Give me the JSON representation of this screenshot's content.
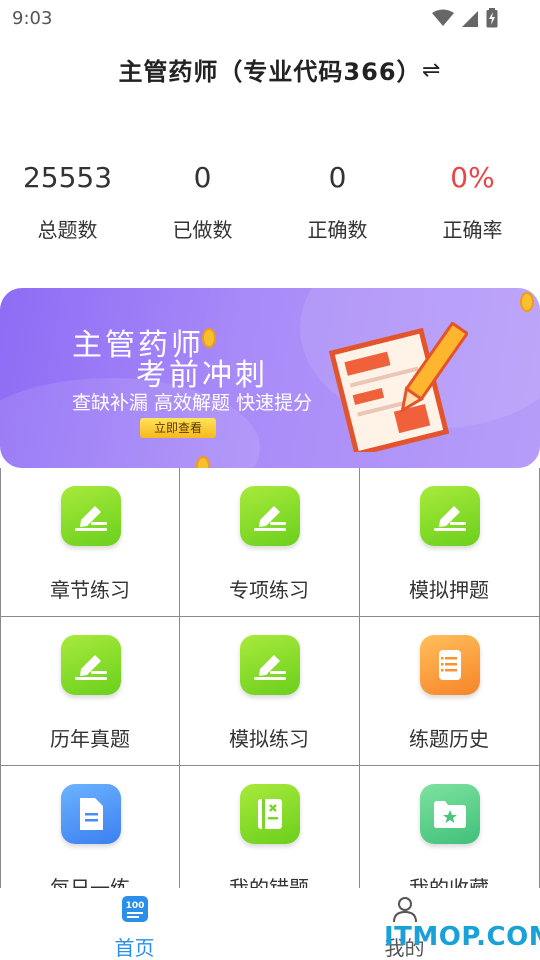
{
  "status_bar": {
    "time": "9:03",
    "icons": [
      "wifi-icon",
      "signal-icon",
      "battery-icon"
    ]
  },
  "header": {
    "title": "主管药师（专业代码366）",
    "switch_icon": "⇌"
  },
  "stats": [
    {
      "value": "25553",
      "label": "总题数",
      "color": "#333333"
    },
    {
      "value": "0",
      "label": "已做数",
      "color": "#333333"
    },
    {
      "value": "0",
      "label": "正确数",
      "color": "#333333"
    },
    {
      "value": "0%",
      "label": "正确率",
      "color": "#e84646"
    }
  ],
  "banner": {
    "title_line1": "主管药师",
    "title_line2": "考前冲刺",
    "subtitle": "查缺补漏 高效解题 快速提分",
    "cta": "立即查看"
  },
  "grid": [
    {
      "label": "章节练习",
      "icon": "pencil-icon",
      "color": "green"
    },
    {
      "label": "专项练习",
      "icon": "pencil-icon",
      "color": "green"
    },
    {
      "label": "模拟押题",
      "icon": "pencil-icon",
      "color": "green"
    },
    {
      "label": "历年真题",
      "icon": "pencil-icon",
      "color": "green"
    },
    {
      "label": "模拟练习",
      "icon": "pencil-icon",
      "color": "green"
    },
    {
      "label": "练题历史",
      "icon": "scroll-icon",
      "color": "orange"
    },
    {
      "label": "每日一练",
      "icon": "document-icon",
      "color": "blue"
    },
    {
      "label": "我的错题",
      "icon": "error-book-icon",
      "color": "green"
    },
    {
      "label": "我的收藏",
      "icon": "star-folder-icon",
      "color": "teal"
    }
  ],
  "bottom_nav": [
    {
      "label": "首页",
      "icon": "home-100-icon",
      "active": true
    },
    {
      "label": "我的",
      "icon": "person-icon",
      "active": false
    }
  ],
  "watermark": "ITMOP.COM"
}
